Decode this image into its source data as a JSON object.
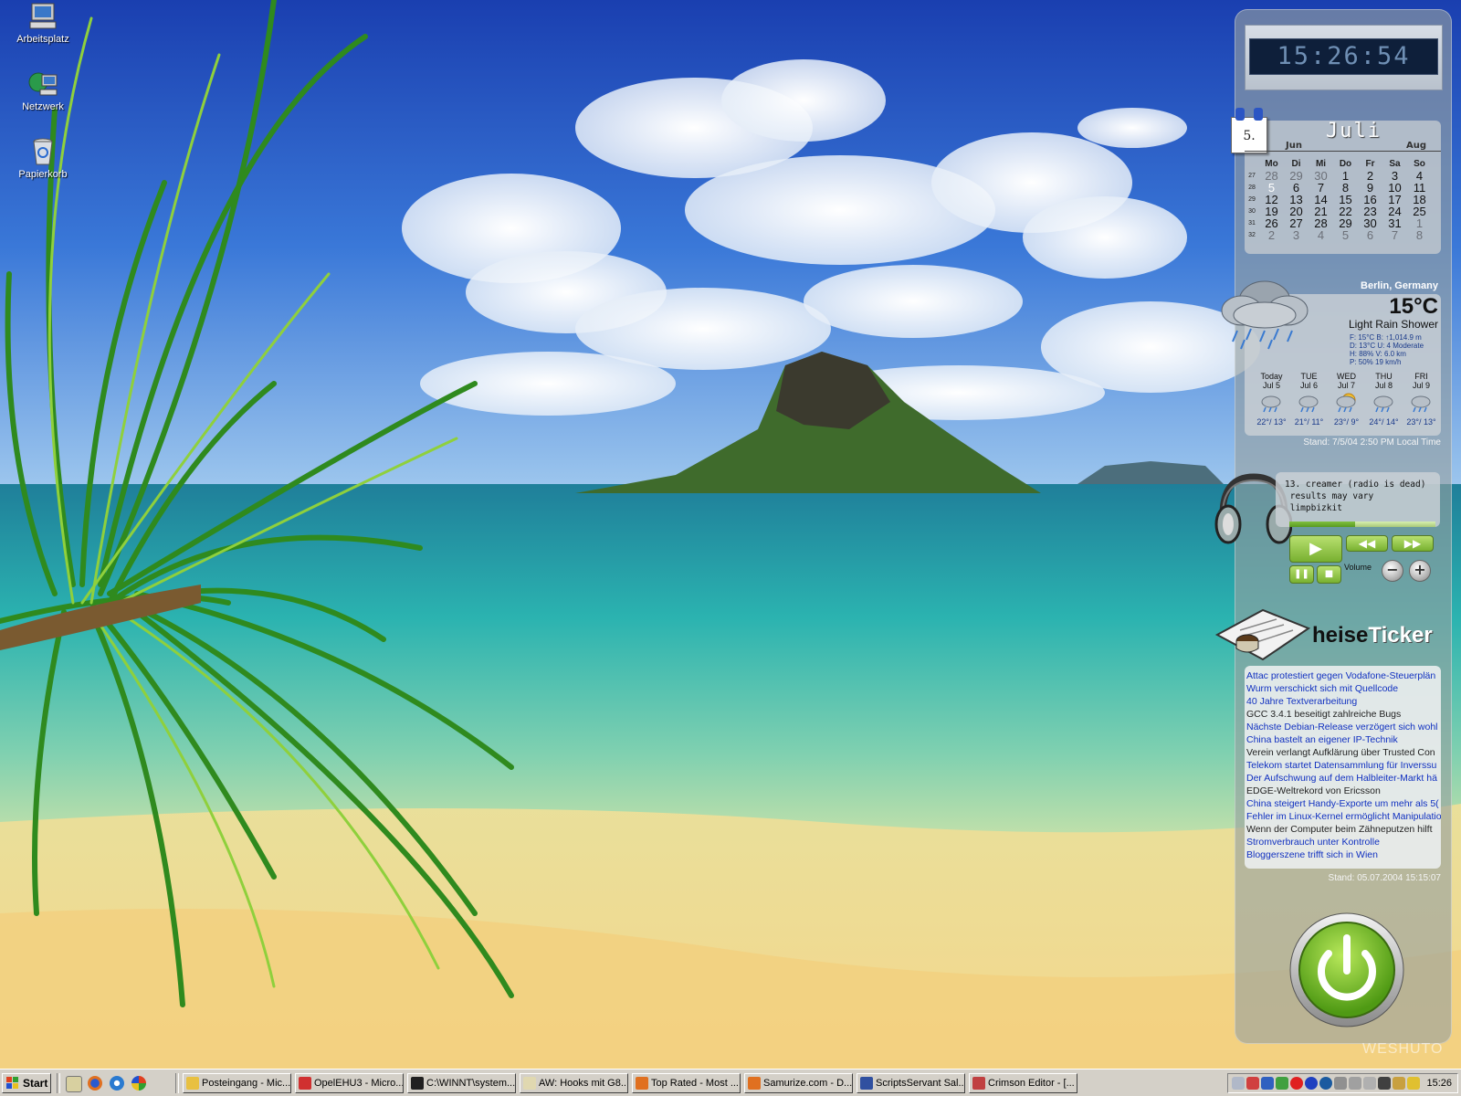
{
  "desktop": {
    "icons": [
      {
        "label": "Arbeitsplatz"
      },
      {
        "label": "Netzwerk"
      },
      {
        "label": "Papierkorb"
      }
    ]
  },
  "clock": {
    "time": "15:26:54"
  },
  "calendar": {
    "badge_day": "5.",
    "month": "Juli",
    "prev_month": "Jun",
    "next_month": "Aug",
    "weekdays": [
      "Mo",
      "Di",
      "Mi",
      "Do",
      "Fr",
      "Sa",
      "So"
    ],
    "weeks": [
      {
        "wk": "27",
        "days": [
          "28",
          "29",
          "30",
          "1",
          "2",
          "3",
          "4"
        ],
        "other": [
          true,
          true,
          true,
          false,
          false,
          false,
          false
        ]
      },
      {
        "wk": "28",
        "days": [
          "5",
          "6",
          "7",
          "8",
          "9",
          "10",
          "11"
        ],
        "other": [
          false,
          false,
          false,
          false,
          false,
          false,
          false
        ]
      },
      {
        "wk": "29",
        "days": [
          "12",
          "13",
          "14",
          "15",
          "16",
          "17",
          "18"
        ],
        "other": [
          false,
          false,
          false,
          false,
          false,
          false,
          false
        ]
      },
      {
        "wk": "30",
        "days": [
          "19",
          "20",
          "21",
          "22",
          "23",
          "24",
          "25"
        ],
        "other": [
          false,
          false,
          false,
          false,
          false,
          false,
          false
        ]
      },
      {
        "wk": "31",
        "days": [
          "26",
          "27",
          "28",
          "29",
          "30",
          "31",
          "1"
        ],
        "other": [
          false,
          false,
          false,
          false,
          false,
          false,
          true
        ]
      },
      {
        "wk": "32",
        "days": [
          "2",
          "3",
          "4",
          "5",
          "6",
          "7",
          "8"
        ],
        "other": [
          true,
          true,
          true,
          true,
          true,
          true,
          true
        ]
      }
    ],
    "today": "5"
  },
  "weather": {
    "location": "Berlin, Germany",
    "temp": "15°C",
    "condition": "Light Rain Shower",
    "details": [
      "F: 15°C  B: ↑1,014.9 m",
      "D: 13°C  U: 4 Moderate",
      "H: 88%  V: 6.0 km",
      "P: 50%       19 km/h"
    ],
    "forecast": [
      {
        "day": "Today",
        "date": "Jul 5",
        "temps": "22°/ 13°",
        "icon": "rain-icon"
      },
      {
        "day": "TUE",
        "date": "Jul 6",
        "temps": "21°/ 11°",
        "icon": "rain-icon"
      },
      {
        "day": "WED",
        "date": "Jul 7",
        "temps": "23°/ 9°",
        "icon": "sun-rain-icon"
      },
      {
        "day": "THU",
        "date": "Jul 8",
        "temps": "24°/ 14°",
        "icon": "rain-icon"
      },
      {
        "day": "FRI",
        "date": "Jul 9",
        "temps": "23°/ 13°",
        "icon": "rain-icon"
      }
    ],
    "stand": "Stand:  7/5/04  2:50 PM Local Time"
  },
  "player": {
    "line1": "13. creamer (radio is dead)",
    "line2": " results may vary",
    "line3": " limpbizkit",
    "progress": 0.45,
    "volume_label": "Volume"
  },
  "heise": {
    "logo_a": "heise",
    "logo_b": "Ticker",
    "items": [
      {
        "text": "Attac protestiert gegen Vodafone-Steuerplän",
        "visited": false
      },
      {
        "text": "Wurm verschickt sich mit Quellcode",
        "visited": false
      },
      {
        "text": "40 Jahre Textverarbeitung",
        "visited": false
      },
      {
        "text": "GCC 3.4.1 beseitigt zahlreiche Bugs",
        "visited": true
      },
      {
        "text": "Nächste Debian-Release verzögert sich wohl",
        "visited": false
      },
      {
        "text": "China bastelt an eigener IP-Technik",
        "visited": false
      },
      {
        "text": "Verein verlangt Aufklärung über Trusted Con",
        "visited": true
      },
      {
        "text": "Telekom startet Datensammlung für Inverssu",
        "visited": false
      },
      {
        "text": "Der Aufschwung auf dem Halbleiter-Markt hä",
        "visited": false
      },
      {
        "text": "EDGE-Weltrekord von Ericsson",
        "visited": true
      },
      {
        "text": "China steigert Handy-Exporte um mehr als 5(",
        "visited": false
      },
      {
        "text": "Fehler im Linux-Kernel ermöglicht Manipulatio",
        "visited": false
      },
      {
        "text": "Wenn der Computer beim Zähneputzen hilft",
        "visited": true
      },
      {
        "text": "Stromverbrauch unter Kontrolle",
        "visited": false
      },
      {
        "text": "Bloggerszene trifft sich in Wien",
        "visited": false
      }
    ],
    "stand": "Stand: 05.07.2004 15:15:07"
  },
  "watermark": "WESHUTO",
  "taskbar": {
    "start_label": "Start",
    "buttons": [
      {
        "label": "Posteingang - Mic...",
        "color": "#e8c040"
      },
      {
        "label": "OpelEHU3 - Micro...",
        "color": "#d03030"
      },
      {
        "label": "C:\\WINNT\\system...",
        "color": "#202020"
      },
      {
        "label": "AW: Hooks mit G8...",
        "color": "#e0d8b0"
      },
      {
        "label": "Top Rated - Most ...",
        "color": "#e07020"
      },
      {
        "label": "Samurize.com - D...",
        "color": "#e07020"
      },
      {
        "label": "ScriptsServant Sal...",
        "color": "#3050a0"
      },
      {
        "label": "Crimson Editor - [...",
        "color": "#c04040"
      }
    ],
    "clock": "15:26"
  }
}
